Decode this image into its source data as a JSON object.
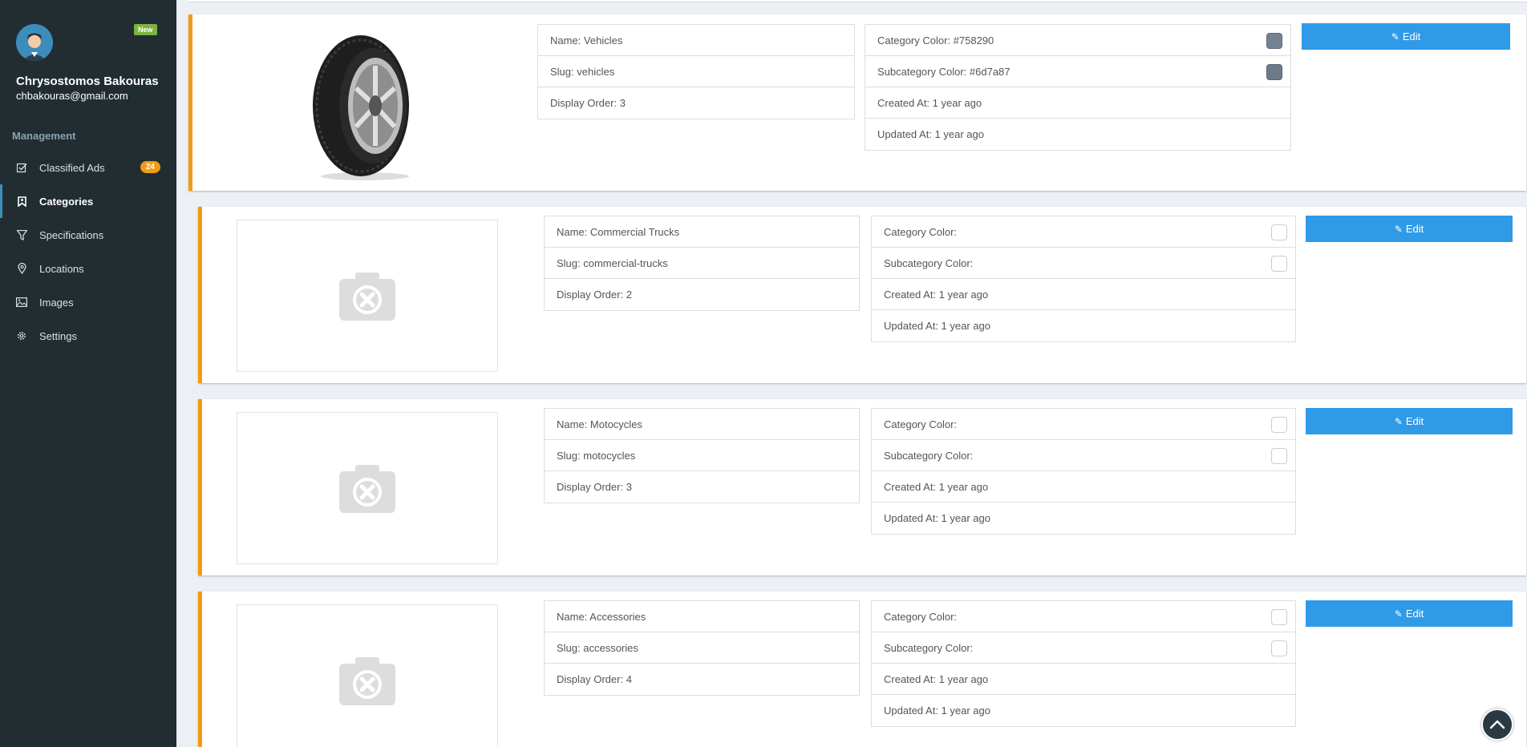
{
  "user": {
    "name": "Chrysostomos Bakouras",
    "email": "chbakouras@gmail.com",
    "badge": "New"
  },
  "sidebar": {
    "section": "Management",
    "items": [
      {
        "label": "Classified Ads",
        "icon": "checkbox-icon",
        "badge": "24"
      },
      {
        "label": "Categories",
        "icon": "bookmark-icon",
        "active": true
      },
      {
        "label": "Specifications",
        "icon": "filter-icon"
      },
      {
        "label": "Locations",
        "icon": "map-pin-icon"
      },
      {
        "label": "Images",
        "icon": "image-icon"
      },
      {
        "label": "Settings",
        "icon": "gear-icon"
      }
    ]
  },
  "categories": [
    {
      "name": "Name: Vehicles",
      "slug": "Slug: vehicles",
      "display_order": "Display Order: 3",
      "category_color": "Category Color: #758290",
      "subcategory_color": "Subcategory Color: #6d7a87",
      "category_swatch": "#758290",
      "subcategory_swatch": "#6d7a87",
      "created": "Created At: 1 year ago",
      "updated": "Updated At: 1 year ago",
      "edit": "Edit",
      "image": "tire"
    },
    {
      "name": "Name: Commercial Trucks",
      "slug": "Slug: commercial-trucks",
      "display_order": "Display Order: 2",
      "category_color": "Category Color:",
      "subcategory_color": "Subcategory Color:",
      "created": "Created At: 1 year ago",
      "updated": "Updated At: 1 year ago",
      "edit": "Edit",
      "image": "placeholder"
    },
    {
      "name": "Name: Motocycles",
      "slug": "Slug: motocycles",
      "display_order": "Display Order: 3",
      "category_color": "Category Color:",
      "subcategory_color": "Subcategory Color:",
      "created": "Created At: 1 year ago",
      "updated": "Updated At: 1 year ago",
      "edit": "Edit",
      "image": "placeholder"
    },
    {
      "name": "Name: Accessories",
      "slug": "Slug: accessories",
      "display_order": "Display Order: 4",
      "category_color": "Category Color:",
      "subcategory_color": "Subcategory Color:",
      "created": "Created At: 1 year ago",
      "updated": "Updated At: 1 year ago",
      "edit": "Edit",
      "image": "placeholder"
    }
  ],
  "colors": {
    "sidebar_bg": "#222d32",
    "accent_border": "#f39c12",
    "edit_button": "#2f9be8",
    "badge_orange": "#f39c12",
    "badge_green": "#7cb342"
  }
}
